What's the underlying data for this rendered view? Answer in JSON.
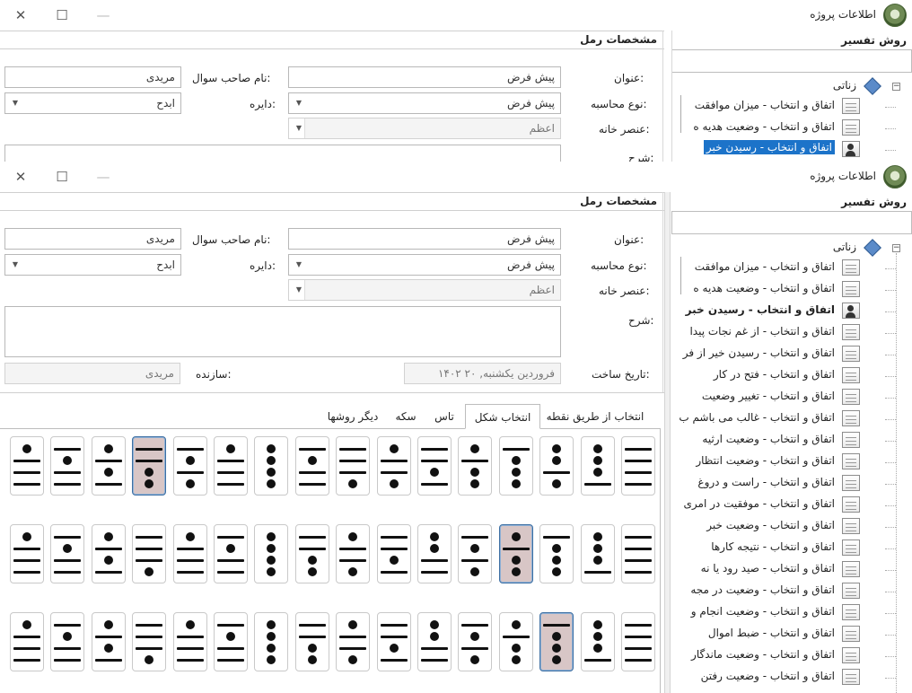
{
  "window": {
    "title": "اطلاعات پروژه",
    "close_glyph": "✕",
    "maximize_glyph": "☐",
    "minimize_glyph": "—"
  },
  "form": {
    "caption": "مشخصات رمل",
    "title_label": "عنوان:",
    "title_value": "پیش فرض",
    "asker_label": "نام صاحب سوال:",
    "asker_value": "مریدی",
    "calc_label": "نوع محاسبه:",
    "calc_value": "پیش فرض",
    "circle_label": "دایره:",
    "circle_value": "ابدح",
    "element_label": "عنصر خانه:",
    "element_value": "اعظم",
    "desc_label": "شرح:",
    "desc_value": "",
    "created_label": "تاریخ ساخت:",
    "created_value": "۱۴۰۲ فروردین یکشنبه, ۲۰",
    "creator_label": "سازنده:",
    "creator_value": "مریدی",
    "combo_arrow": "▼"
  },
  "tabs": [
    {
      "label": "انتخاب از طریق نقطه",
      "active": false
    },
    {
      "label": "انتخاب شکل",
      "active": true
    },
    {
      "label": "تاس",
      "active": false
    },
    {
      "label": "سکه",
      "active": false
    },
    {
      "label": "دیگر روشها",
      "active": false
    }
  ],
  "figures": {
    "note": "Each row: 16 geomantic figure cards (right-to-left on screen). Each figure: 4 lines top-to-bottom, 1 = single dot, 2 = double (bar).",
    "rows": [
      {
        "selected_index": 12,
        "cards": [
          [
            2,
            2,
            2,
            2
          ],
          [
            1,
            1,
            1,
            2
          ],
          [
            1,
            1,
            2,
            1
          ],
          [
            2,
            1,
            1,
            1
          ],
          [
            1,
            2,
            1,
            1
          ],
          [
            2,
            2,
            1,
            2
          ],
          [
            1,
            2,
            2,
            1
          ],
          [
            2,
            2,
            2,
            1
          ],
          [
            2,
            1,
            2,
            2
          ],
          [
            1,
            1,
            1,
            1
          ],
          [
            1,
            2,
            2,
            2
          ],
          [
            2,
            1,
            2,
            1
          ],
          [
            2,
            2,
            1,
            1
          ],
          [
            1,
            2,
            1,
            2
          ],
          [
            2,
            1,
            2,
            2
          ],
          [
            1,
            2,
            2,
            2
          ]
        ]
      },
      {
        "selected_index": 3,
        "cards": [
          [
            2,
            2,
            2,
            2
          ],
          [
            1,
            1,
            1,
            2
          ],
          [
            2,
            1,
            1,
            1
          ],
          [
            1,
            2,
            1,
            1
          ],
          [
            2,
            1,
            2,
            1
          ],
          [
            1,
            1,
            2,
            2
          ],
          [
            2,
            2,
            1,
            2
          ],
          [
            1,
            2,
            2,
            1
          ],
          [
            2,
            2,
            1,
            1
          ],
          [
            1,
            1,
            1,
            1
          ],
          [
            2,
            1,
            2,
            2
          ],
          [
            1,
            2,
            2,
            2
          ],
          [
            2,
            2,
            2,
            1
          ],
          [
            1,
            2,
            1,
            2
          ],
          [
            2,
            1,
            2,
            2
          ],
          [
            1,
            2,
            2,
            2
          ]
        ]
      },
      {
        "selected_index": 2,
        "cards": [
          [
            2,
            2,
            2,
            2
          ],
          [
            1,
            1,
            1,
            2
          ],
          [
            2,
            1,
            1,
            1
          ],
          [
            1,
            2,
            1,
            1
          ],
          [
            2,
            1,
            2,
            1
          ],
          [
            1,
            1,
            2,
            2
          ],
          [
            2,
            2,
            1,
            2
          ],
          [
            1,
            2,
            2,
            1
          ],
          [
            2,
            2,
            1,
            1
          ],
          [
            1,
            1,
            1,
            1
          ],
          [
            2,
            1,
            2,
            2
          ],
          [
            1,
            2,
            2,
            2
          ],
          [
            2,
            2,
            2,
            1
          ],
          [
            1,
            2,
            1,
            2
          ],
          [
            2,
            1,
            2,
            2
          ],
          [
            1,
            2,
            2,
            2
          ]
        ]
      }
    ]
  },
  "sidebar": {
    "caption": "روش تفسیر",
    "root_label": "زناتی",
    "collapse_glyph": "−",
    "items": [
      {
        "label": "اتفاق و انتخاب - میزان موافقت",
        "icon": "calendar-icon"
      },
      {
        "label": "اتفاق و انتخاب - وضعیت هدیه ه",
        "icon": "calendar-icon"
      },
      {
        "label": "اتفاق و انتخاب - رسیدن خبر",
        "icon": "person-icon",
        "selected": true
      },
      {
        "label": "اتفاق و انتخاب - از غم نجات پیدا",
        "icon": "calendar-icon"
      },
      {
        "label": "اتفاق و انتخاب - رسیدن خیر از فر",
        "icon": "calendar-icon"
      },
      {
        "label": "اتفاق و انتخاب - فتح در کار",
        "icon": "calendar-icon"
      },
      {
        "label": "اتفاق و انتخاب - تغییر وضعیت",
        "icon": "calendar-icon"
      },
      {
        "label": "اتفاق و انتخاب - غالب می باشم ب",
        "icon": "calendar-icon"
      },
      {
        "label": "اتفاق و انتخاب - وضعیت ارثیه",
        "icon": "calendar-icon"
      },
      {
        "label": "اتفاق و انتخاب - وضعیت انتظار",
        "icon": "calendar-icon"
      },
      {
        "label": "اتفاق و انتخاب - راست و دروغ",
        "icon": "calendar-icon"
      },
      {
        "label": "اتفاق و انتخاب - موفقیت در امری",
        "icon": "calendar-icon"
      },
      {
        "label": "اتفاق و انتخاب - وضعیت خبر",
        "icon": "calendar-icon"
      },
      {
        "label": "اتفاق و انتخاب - نتیجه کارها",
        "icon": "calendar-icon"
      },
      {
        "label": "اتفاق و انتخاب - صید رود یا نه",
        "icon": "calendar-icon"
      },
      {
        "label": "اتفاق و انتخاب - وضعیت در مجه",
        "icon": "calendar-icon"
      },
      {
        "label": "اتفاق و انتخاب - وضعیت انجام و",
        "icon": "calendar-icon"
      },
      {
        "label": "اتفاق و انتخاب - ضبط اموال",
        "icon": "calendar-icon"
      },
      {
        "label": "اتفاق و انتخاب - وضعیت ماندگار",
        "icon": "calendar-icon"
      },
      {
        "label": "اتفاق و انتخاب - وضعیت رفتن",
        "icon": "calendar-icon"
      }
    ]
  }
}
